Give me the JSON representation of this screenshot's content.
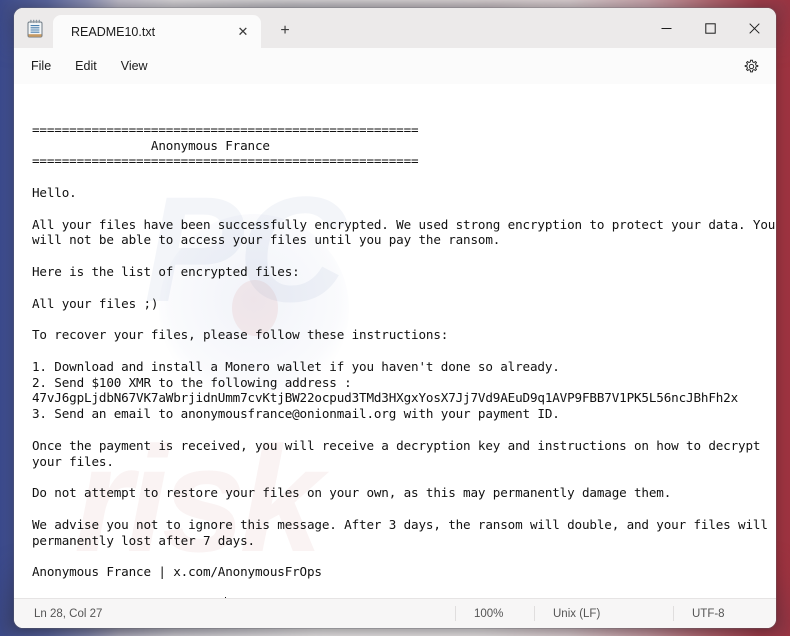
{
  "window": {
    "app_icon": "notepad-icon",
    "controls": {
      "minimize": "—",
      "maximize": "☐",
      "close": "✕"
    }
  },
  "tabs": [
    {
      "title": "README10.txt",
      "close_label": "✕"
    }
  ],
  "new_tab_label": "+",
  "menu": {
    "items": [
      "File",
      "Edit",
      "View"
    ],
    "settings_icon": "gear-icon"
  },
  "document": {
    "lines": [
      "",
      "====================================================",
      "                Anonymous France",
      "====================================================",
      "",
      "Hello.",
      "",
      "All your files have been successfully encrypted. We used strong encryption to protect your data. You",
      "will not be able to access your files until you pay the ransom.",
      "",
      "Here is the list of encrypted files:",
      "",
      "All your files ;)",
      "",
      "To recover your files, please follow these instructions:",
      "",
      "1. Download and install a Monero wallet if you haven't done so already.",
      "2. Send $100 XMR to the following address :",
      "47vJ6gpLjdbN67VK7aWbrjidnUmm7cvKtjBW22ocpud3TMd3HXgxYosX7Jj7Vd9AEuD9q1AVP9FBB7V1PK5L56ncJBhFh2x",
      "3. Send an email to anonymousfrance@onionmail.org with your payment ID.",
      "",
      "Once the payment is received, you will receive a decryption key and instructions on how to decrypt",
      "your files.",
      "",
      "Do not attempt to restore your files on your own, as this may permanently damage them.",
      "",
      "We advise you not to ignore this message. After 3 days, the ransom will double, and your files will be",
      "permanently lost after 7 days.",
      "",
      "Anonymous France | x.com/AnonymousFrOps",
      "",
      "=========================="
    ]
  },
  "watermark": {
    "line1": "PC",
    "line2": "risk"
  },
  "statusbar": {
    "position": "Ln 28, Col 27",
    "zoom": "100%",
    "line_ending": "Unix (LF)",
    "encoding": "UTF-8"
  },
  "colors": {
    "window_bg": "#fbfbfb",
    "titlebar_bg": "#eceaea",
    "editor_bg": "#ffffff",
    "text": "#111111",
    "status_text": "#555555",
    "close_hover": "#e81123"
  }
}
